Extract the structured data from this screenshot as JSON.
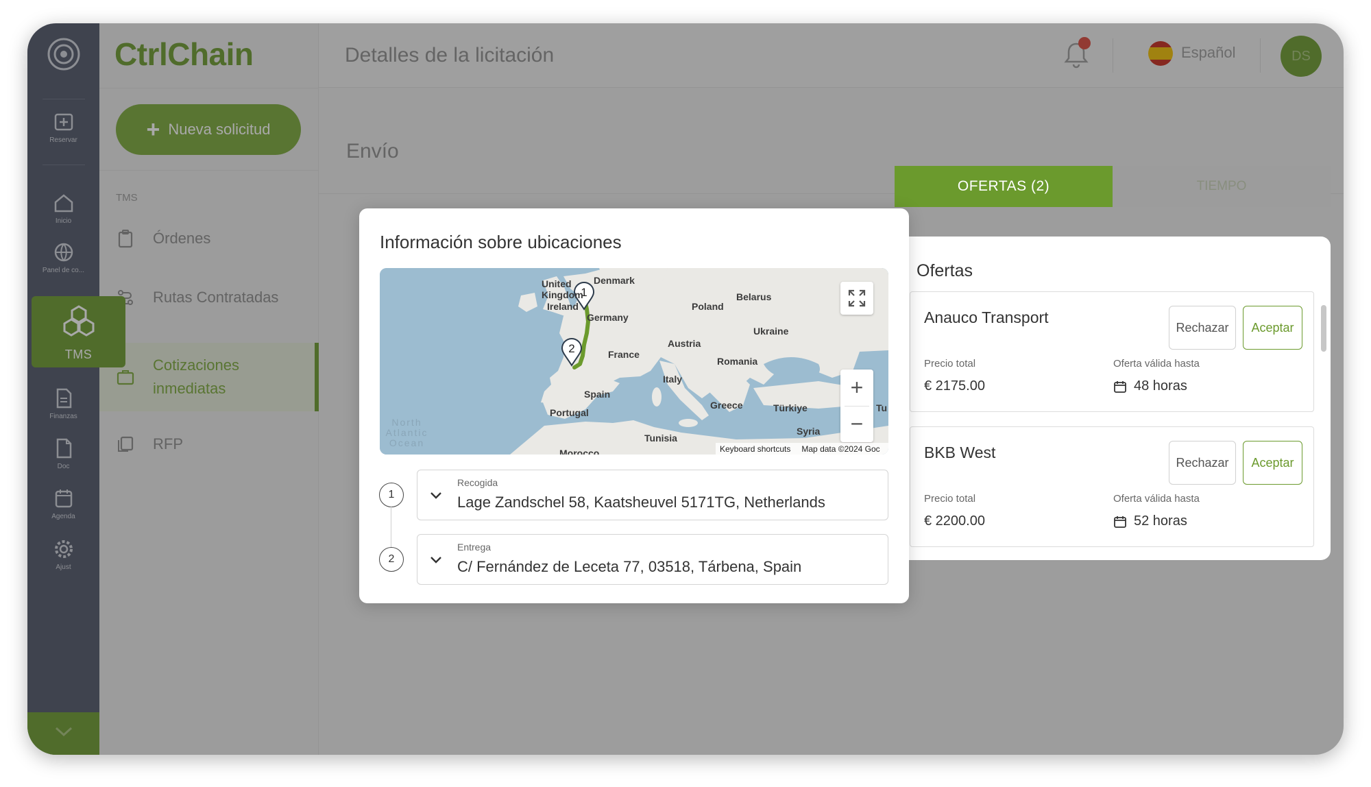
{
  "app": {
    "brand": "CtrlChain",
    "header_title": "Detalles de la licitación",
    "language": "Español",
    "avatar_initials": "DS",
    "accent_color": "#6b9a2d"
  },
  "rail": {
    "items": [
      {
        "label": "Reservar",
        "icon": "box-plus-icon"
      },
      {
        "label": "Inicio",
        "icon": "home-icon"
      },
      {
        "label": "Panel de co...",
        "icon": "globe-icon"
      },
      {
        "label": "TMS",
        "icon": "cubes-icon",
        "active": true
      },
      {
        "label": "Finanzas",
        "icon": "document-icon"
      },
      {
        "label": "Doc",
        "icon": "file-icon"
      },
      {
        "label": "Agenda",
        "icon": "calendar-icon"
      },
      {
        "label": "Ajust",
        "icon": "gear-icon"
      }
    ]
  },
  "sidebar": {
    "new_button": "Nueva solicitud",
    "section": "TMS",
    "items": [
      {
        "label": "Órdenes"
      },
      {
        "label": "Rutas Contratadas"
      },
      {
        "label": "Cotizaciones inmediatas",
        "active": true
      },
      {
        "label": "RFP"
      }
    ]
  },
  "main": {
    "section_title": "Envío"
  },
  "tabs": {
    "active": "OFERTAS (2)",
    "inactive": "TIEMPO"
  },
  "offers": {
    "title": "Ofertas",
    "reject_label": "Rechazar",
    "accept_label": "Aceptar",
    "price_label": "Precio total",
    "valid_label": "Oferta válida hasta",
    "items": [
      {
        "carrier": "Anauco Transport",
        "price": "€ 2175.00",
        "valid": "48 horas"
      },
      {
        "carrier": "BKB West",
        "price": "€ 2200.00",
        "valid": "52 horas"
      }
    ]
  },
  "modal": {
    "title": "Información sobre ubicaciones",
    "map": {
      "labels": {
        "uk": "United Kingdom",
        "ireland": "Ireland",
        "denmark": "Denmark",
        "belarus": "Belarus",
        "poland": "Poland",
        "germany": "Germany",
        "ukraine": "Ukraine",
        "austria": "Austria",
        "france": "France",
        "romania": "Romania",
        "italy": "Italy",
        "spain": "Spain",
        "portugal": "Portugal",
        "greece": "Greece",
        "turkiye": "Türkiye",
        "tu": "Tu",
        "syria": "Syria",
        "tunisia": "Tunisia",
        "morocco": "Morocco",
        "ocean": "North Atlantic Ocean"
      },
      "keyboard_shortcuts": "Keyboard shortcuts",
      "map_data": "Map data ©2024 Goc",
      "marker_1": "1",
      "marker_2": "2",
      "route_color": "#6b9a2d",
      "zoom_in": "+",
      "zoom_out": "−"
    },
    "stops": [
      {
        "number": "1",
        "type": "Recogida",
        "address": "Lage Zandschel 58, Kaatsheuvel 5171TG, Netherlands"
      },
      {
        "number": "2",
        "type": "Entrega",
        "address": "C/ Fernández de Leceta 77, 03518, Tárbena, Spain"
      }
    ]
  }
}
